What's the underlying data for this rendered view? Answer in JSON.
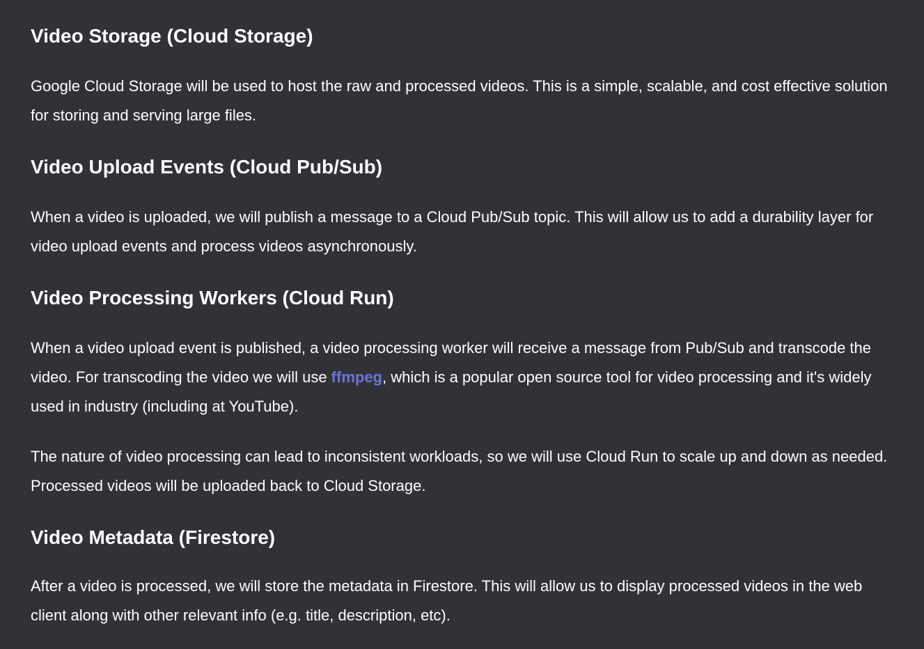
{
  "sections": [
    {
      "heading": "Video Storage (Cloud Storage)",
      "paragraphs": [
        "Google Cloud Storage will be used to host the raw and processed videos. This is a simple, scalable, and cost effective solution for storing and serving large files."
      ]
    },
    {
      "heading": "Video Upload Events (Cloud Pub/Sub)",
      "paragraphs": [
        "When a video is uploaded, we will publish a message to a Cloud Pub/Sub topic. This will allow us to add a durability layer for video upload events and process videos asynchronously."
      ]
    },
    {
      "heading": "Video Processing Workers (Cloud Run)",
      "paragraph1": {
        "before_link": "When a video upload event is published, a video processing worker will receive a message from Pub/Sub and transcode the video. For transcoding the video we will use ",
        "link_text": "ffmpeg",
        "after_link": ", which is a popular open source tool for video processing and it's widely used in industry (including at YouTube)."
      },
      "paragraph2": "The nature of video processing can lead to inconsistent workloads, so we will use Cloud Run to scale up and down as needed. Processed videos will be uploaded back to Cloud Storage."
    },
    {
      "heading": "Video Metadata (Firestore)",
      "paragraphs": [
        "After a video is processed, we will store the metadata in Firestore. This will allow us to display processed videos in the web client along with other relevant info (e.g. title, description, etc)."
      ]
    }
  ],
  "colors": {
    "background": "#313238",
    "text": "#ffffff",
    "link": "#6b74d6"
  }
}
